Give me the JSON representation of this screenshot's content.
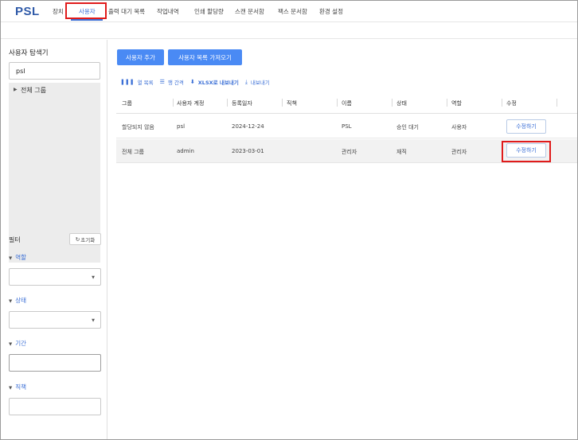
{
  "app": {
    "logo": "PSL"
  },
  "nav": {
    "items": [
      {
        "label": "장치",
        "active": false
      },
      {
        "label": "사용자",
        "active": true
      },
      {
        "label": "출력 대기 목록",
        "active": false
      },
      {
        "label": "작업내역",
        "active": false
      },
      {
        "label": "인쇄 할당량",
        "active": false
      },
      {
        "label": "스캔 문서함",
        "active": false
      },
      {
        "label": "팩스 문서함",
        "active": false
      },
      {
        "label": "환경 설정",
        "active": false
      }
    ]
  },
  "sidebar": {
    "title": "사용자 탐색기",
    "search_value": "psl",
    "tree_root": "전체 그룹",
    "filter_title": "필터",
    "reset_label": "초기화",
    "filters": {
      "role": "역할",
      "status": "상태",
      "period": "기간",
      "position": "직책"
    }
  },
  "main": {
    "add_user_label": "사용자 추가",
    "import_label": "사용자 목록 가져오기",
    "toolbar": {
      "columns_label": "열 목록",
      "density_label": "행 간격",
      "export_xlsx_label": "XLSX로 내보내기",
      "export_label": "내보내기"
    },
    "table": {
      "headers": [
        "그룹",
        "사용자 계정",
        "등록일자",
        "직책",
        "이름",
        "상태",
        "역할",
        "수정"
      ],
      "rows": [
        [
          "할당되지 않음",
          "psl",
          "2024-12-24",
          "",
          "PSL",
          "승인 대기",
          "사용자",
          "수정하기"
        ],
        [
          "전체 그룹",
          "admin",
          "2023-03-01",
          "",
          "관리자",
          "재직",
          "관리자",
          "수정하기"
        ]
      ]
    }
  },
  "colors": {
    "accent": "#3b6fd6",
    "primary_button": "#4a8af4",
    "highlight": "#e01b1b",
    "logo": "#2f5aa8"
  }
}
